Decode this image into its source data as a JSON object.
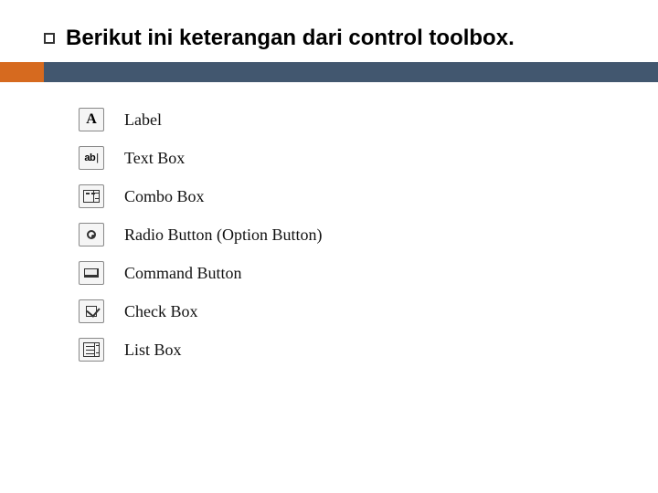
{
  "heading": "Berikut ini keterangan dari control toolbox.",
  "items": [
    {
      "icon": "label-icon",
      "label": "Label"
    },
    {
      "icon": "textbox-icon",
      "label": "Text Box"
    },
    {
      "icon": "combobox-icon",
      "label": "Combo Box"
    },
    {
      "icon": "radio-icon",
      "label": "Radio Button (Option Button)"
    },
    {
      "icon": "command-icon",
      "label": "Command Button"
    },
    {
      "icon": "checkbox-icon",
      "label": "Check Box"
    },
    {
      "icon": "listbox-icon",
      "label": "List Box"
    }
  ],
  "colors": {
    "accentOrange": "#d66a1f",
    "accentNavy": "#42576f"
  }
}
